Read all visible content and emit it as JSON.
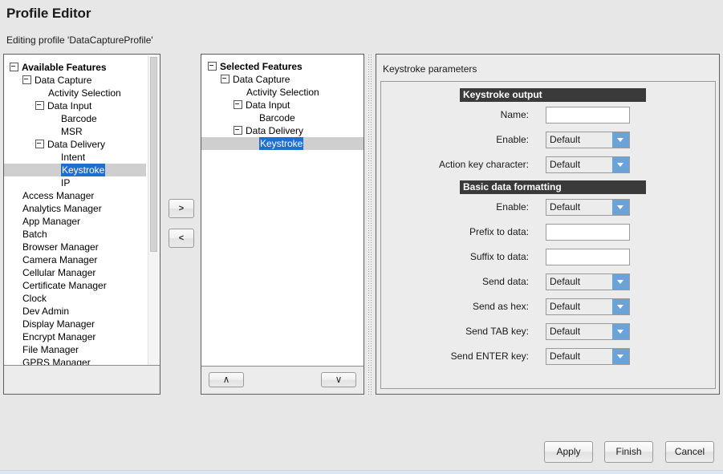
{
  "window": {
    "title": "Profile Editor",
    "subtitle": "Editing profile 'DataCaptureProfile'"
  },
  "colors": {
    "selection_blue": "#1f6fcf",
    "section_header_bg": "#3a3a3a",
    "combo_arrow_blue": "#6ba3d6",
    "panel_bg": "#ececec",
    "row_highlight": "#cfcfcf"
  },
  "available_panel": {
    "root_label": "Available Features",
    "tree": [
      {
        "label": "Available Features",
        "indent": 0,
        "expander": "collapse",
        "bold": true,
        "selected": false
      },
      {
        "label": "Data Capture",
        "indent": 1,
        "expander": "collapse",
        "bold": false,
        "selected": false
      },
      {
        "label": "Activity Selection",
        "indent": 3,
        "expander": "none",
        "bold": false,
        "selected": false
      },
      {
        "label": "Data Input",
        "indent": 2,
        "expander": "collapse",
        "bold": false,
        "selected": false
      },
      {
        "label": "Barcode",
        "indent": 4,
        "expander": "none",
        "bold": false,
        "selected": false
      },
      {
        "label": "MSR",
        "indent": 4,
        "expander": "none",
        "bold": false,
        "selected": false
      },
      {
        "label": "Data Delivery",
        "indent": 2,
        "expander": "collapse",
        "bold": false,
        "selected": false
      },
      {
        "label": "Intent",
        "indent": 4,
        "expander": "none",
        "bold": false,
        "selected": false
      },
      {
        "label": "Keystroke",
        "indent": 4,
        "expander": "none",
        "bold": false,
        "selected": true
      },
      {
        "label": "IP",
        "indent": 4,
        "expander": "none",
        "bold": false,
        "selected": false
      },
      {
        "label": "Access Manager",
        "indent": 1,
        "expander": "none",
        "bold": false,
        "selected": false
      },
      {
        "label": "Analytics Manager",
        "indent": 1,
        "expander": "none",
        "bold": false,
        "selected": false
      },
      {
        "label": "App Manager",
        "indent": 1,
        "expander": "none",
        "bold": false,
        "selected": false
      },
      {
        "label": "Batch",
        "indent": 1,
        "expander": "none",
        "bold": false,
        "selected": false
      },
      {
        "label": "Browser Manager",
        "indent": 1,
        "expander": "none",
        "bold": false,
        "selected": false
      },
      {
        "label": "Camera Manager",
        "indent": 1,
        "expander": "none",
        "bold": false,
        "selected": false
      },
      {
        "label": "Cellular Manager",
        "indent": 1,
        "expander": "none",
        "bold": false,
        "selected": false
      },
      {
        "label": "Certificate Manager",
        "indent": 1,
        "expander": "none",
        "bold": false,
        "selected": false
      },
      {
        "label": "Clock",
        "indent": 1,
        "expander": "none",
        "bold": false,
        "selected": false
      },
      {
        "label": "Dev Admin",
        "indent": 1,
        "expander": "none",
        "bold": false,
        "selected": false
      },
      {
        "label": "Display Manager",
        "indent": 1,
        "expander": "none",
        "bold": false,
        "selected": false
      },
      {
        "label": "Encrypt Manager",
        "indent": 1,
        "expander": "none",
        "bold": false,
        "selected": false
      },
      {
        "label": "File Manager",
        "indent": 1,
        "expander": "none",
        "bold": false,
        "selected": false
      },
      {
        "label": "GPRS Manager",
        "indent": 1,
        "expander": "none",
        "bold": false,
        "selected": false
      }
    ]
  },
  "transfer_buttons": {
    "add_label": ">",
    "remove_label": "<"
  },
  "selected_panel": {
    "root_label": "Selected Features",
    "tree": [
      {
        "label": "Selected Features",
        "indent": 0,
        "expander": "collapse",
        "bold": true,
        "selected": false
      },
      {
        "label": "Data Capture",
        "indent": 1,
        "expander": "collapse",
        "bold": false,
        "selected": false
      },
      {
        "label": "Activity Selection",
        "indent": 3,
        "expander": "none",
        "bold": false,
        "selected": false
      },
      {
        "label": "Data Input",
        "indent": 2,
        "expander": "collapse",
        "bold": false,
        "selected": false
      },
      {
        "label": "Barcode",
        "indent": 4,
        "expander": "none",
        "bold": false,
        "selected": false
      },
      {
        "label": "Data Delivery",
        "indent": 2,
        "expander": "collapse",
        "bold": false,
        "selected": false
      },
      {
        "label": "Keystroke",
        "indent": 4,
        "expander": "none",
        "bold": false,
        "selected": true
      }
    ],
    "order_up_label": "∧",
    "order_down_label": "∨"
  },
  "params_panel": {
    "title": "Keystroke parameters",
    "sections": [
      {
        "header": "Keystroke output",
        "fields": [
          {
            "label": "Name:",
            "type": "text",
            "value": ""
          },
          {
            "label": "Enable:",
            "type": "combo",
            "value": "Default"
          },
          {
            "label": "Action key character:",
            "type": "combo",
            "value": "Default"
          }
        ]
      },
      {
        "header": "Basic data formatting",
        "fields": [
          {
            "label": "Enable:",
            "type": "combo",
            "value": "Default"
          },
          {
            "label": "Prefix to data:",
            "type": "text",
            "value": ""
          },
          {
            "label": "Suffix to data:",
            "type": "text",
            "value": ""
          },
          {
            "label": "Send data:",
            "type": "combo",
            "value": "Default"
          },
          {
            "label": "Send as hex:",
            "type": "combo",
            "value": "Default"
          },
          {
            "label": "Send TAB key:",
            "type": "combo",
            "value": "Default"
          },
          {
            "label": "Send ENTER key:",
            "type": "combo",
            "value": "Default"
          }
        ]
      }
    ]
  },
  "dialog_buttons": {
    "apply": "Apply",
    "finish": "Finish",
    "cancel": "Cancel"
  }
}
